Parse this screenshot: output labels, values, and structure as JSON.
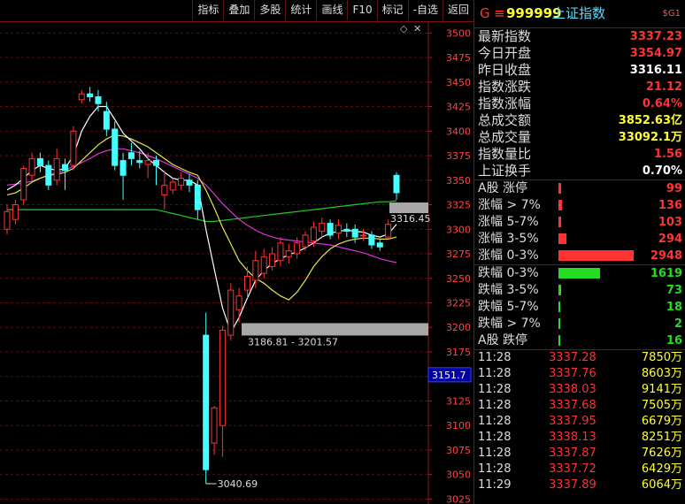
{
  "toolbar": [
    "指标",
    "叠加",
    "多股",
    "统计",
    "画线",
    "F10",
    "标记",
    "-自选",
    "返回"
  ],
  "yaxis": {
    "ticks": [
      3500,
      3475,
      3450,
      3425,
      3400,
      3375,
      3350,
      3325,
      3300,
      3275,
      3250,
      3225,
      3200,
      3175,
      3150,
      3125,
      3100,
      3075,
      3050,
      3025
    ]
  },
  "price_tag": "3316.45",
  "current_tag": "3151.7",
  "range_label": "3186.81 - 3201.57",
  "low_label": "3040.69",
  "header": {
    "g": "G",
    "eq": "≡",
    "code": "999999",
    "name": "上证指数",
    "sg": "$G1"
  },
  "quote": [
    {
      "label": "最新指数",
      "value": "3337.23",
      "color": "#ff3333"
    },
    {
      "label": "今日开盘",
      "value": "3354.97",
      "color": "#ff3333"
    },
    {
      "label": "昨日收盘",
      "value": "3316.11",
      "color": "#ffffff"
    },
    {
      "label": "指数涨跌",
      "value": "21.12",
      "color": "#ff3333"
    },
    {
      "label": "指数涨幅",
      "value": "0.64%",
      "color": "#ff3333"
    },
    {
      "label": "总成交额",
      "value": "3852.63亿",
      "color": "#ffff33"
    },
    {
      "label": "总成交量",
      "value": "33092.1万",
      "color": "#ffff33"
    },
    {
      "label": "指数量比",
      "value": "1.56",
      "color": "#ff3333"
    },
    {
      "label": "上证换手",
      "value": "0.70%",
      "color": "#ffffff"
    }
  ],
  "dist_up": [
    {
      "label": "A股 涨停",
      "value": "99",
      "bar": 0.04
    },
    {
      "label": "涨幅 > 7%",
      "value": "136",
      "bar": 0.05
    },
    {
      "label": "涨幅 5-7%",
      "value": "103",
      "bar": 0.04
    },
    {
      "label": "涨幅 3-5%",
      "value": "294",
      "bar": 0.1
    },
    {
      "label": "涨幅 0-3%",
      "value": "2948",
      "bar": 1.0
    }
  ],
  "dist_down": [
    {
      "label": "跌幅 0-3%",
      "value": "1619",
      "bar": 0.55
    },
    {
      "label": "跌幅 3-5%",
      "value": "73",
      "bar": 0.03
    },
    {
      "label": "跌幅 5-7%",
      "value": "18",
      "bar": 0.01
    },
    {
      "label": "跌幅 > 7%",
      "value": "2",
      "bar": 0.01
    },
    {
      "label": "A股 跌停",
      "value": "16",
      "bar": 0.01
    }
  ],
  "ticks": [
    {
      "time": "11:28",
      "price": "3337.28",
      "vol": "7850万"
    },
    {
      "time": "11:28",
      "price": "3337.76",
      "vol": "8603万"
    },
    {
      "time": "11:28",
      "price": "3338.03",
      "vol": "9141万"
    },
    {
      "time": "11:28",
      "price": "3337.68",
      "vol": "7505万"
    },
    {
      "time": "11:28",
      "price": "3337.95",
      "vol": "6679万"
    },
    {
      "time": "11:28",
      "price": "3338.13",
      "vol": "8251万"
    },
    {
      "time": "11:28",
      "price": "3337.87",
      "vol": "7626万"
    },
    {
      "time": "11:28",
      "price": "3337.72",
      "vol": "6429万"
    },
    {
      "time": "11:29",
      "price": "3337.89",
      "vol": "6064万"
    }
  ],
  "chart_data": {
    "type": "candlestick",
    "ylim": [
      3020,
      3512
    ],
    "candles": [
      {
        "o": 3300,
        "c": 3318,
        "h": 3325,
        "l": 3295
      },
      {
        "o": 3310,
        "c": 3325,
        "h": 3330,
        "l": 3305
      },
      {
        "o": 3330,
        "c": 3362,
        "h": 3365,
        "l": 3325
      },
      {
        "o": 3355,
        "c": 3372,
        "h": 3378,
        "l": 3350
      },
      {
        "o": 3372,
        "c": 3365,
        "h": 3378,
        "l": 3358
      },
      {
        "o": 3365,
        "c": 3345,
        "h": 3370,
        "l": 3340
      },
      {
        "o": 3350,
        "c": 3372,
        "h": 3382,
        "l": 3345
      },
      {
        "o": 3366,
        "c": 3360,
        "h": 3372,
        "l": 3340
      },
      {
        "o": 3365,
        "c": 3400,
        "h": 3405,
        "l": 3360
      },
      {
        "o": 3432,
        "c": 3438,
        "h": 3442,
        "l": 3428
      },
      {
        "o": 3438,
        "c": 3435,
        "h": 3445,
        "l": 3430
      },
      {
        "o": 3435,
        "c": 3428,
        "h": 3442,
        "l": 3420
      },
      {
        "o": 3420,
        "c": 3402,
        "h": 3430,
        "l": 3395
      },
      {
        "o": 3402,
        "c": 3365,
        "h": 3410,
        "l": 3360
      },
      {
        "o": 3370,
        "c": 3355,
        "h": 3378,
        "l": 3330
      },
      {
        "o": 3378,
        "c": 3372,
        "h": 3388,
        "l": 3365
      },
      {
        "o": 3370,
        "c": 3368,
        "h": 3380,
        "l": 3362
      },
      {
        "o": 3366,
        "c": 3370,
        "h": 3378,
        "l": 3352
      },
      {
        "o": 3370,
        "c": 3365,
        "h": 3375,
        "l": 3345
      },
      {
        "o": 3335,
        "c": 3345,
        "h": 3360,
        "l": 3320
      },
      {
        "o": 3340,
        "c": 3348,
        "h": 3352,
        "l": 3336
      },
      {
        "o": 3345,
        "c": 3352,
        "h": 3358,
        "l": 3340
      },
      {
        "o": 3350,
        "c": 3345,
        "h": 3356,
        "l": 3338
      },
      {
        "o": 3345,
        "c": 3320,
        "h": 3350,
        "l": 3310
      },
      {
        "o": 3192,
        "c": 3055,
        "h": 3215,
        "l": 3040.69
      },
      {
        "o": 3082,
        "c": 3118,
        "h": 3120,
        "l": 3070
      },
      {
        "o": 3100,
        "c": 3197,
        "h": 3201.57,
        "l": 3068
      },
      {
        "o": 3192,
        "c": 3238,
        "h": 3245,
        "l": 3186.81
      },
      {
        "o": 3218,
        "c": 3232,
        "h": 3240,
        "l": 3205
      },
      {
        "o": 3238,
        "c": 3252,
        "h": 3262,
        "l": 3230
      },
      {
        "o": 3248,
        "c": 3268,
        "h": 3278,
        "l": 3240
      },
      {
        "o": 3255,
        "c": 3272,
        "h": 3280,
        "l": 3250
      },
      {
        "o": 3262,
        "c": 3275,
        "h": 3282,
        "l": 3258
      },
      {
        "o": 3268,
        "c": 3286,
        "h": 3292,
        "l": 3262
      },
      {
        "o": 3272,
        "c": 3278,
        "h": 3285,
        "l": 3265
      },
      {
        "o": 3275,
        "c": 3286,
        "h": 3292,
        "l": 3270
      },
      {
        "o": 3282,
        "c": 3294,
        "h": 3298,
        "l": 3278
      },
      {
        "o": 3288,
        "c": 3302,
        "h": 3308,
        "l": 3282
      },
      {
        "o": 3298,
        "c": 3306,
        "h": 3312,
        "l": 3292
      },
      {
        "o": 3306,
        "c": 3294,
        "h": 3310,
        "l": 3290
      },
      {
        "o": 3296,
        "c": 3304,
        "h": 3310,
        "l": 3290
      },
      {
        "o": 3300,
        "c": 3298,
        "h": 3306,
        "l": 3292
      },
      {
        "o": 3300,
        "c": 3292,
        "h": 3305,
        "l": 3286
      },
      {
        "o": 3294,
        "c": 3294,
        "h": 3300,
        "l": 3288
      },
      {
        "o": 3294,
        "c": 3284,
        "h": 3298,
        "l": 3280
      },
      {
        "o": 3286,
        "c": 3282,
        "h": 3290,
        "l": 3278
      },
      {
        "o": 3292,
        "c": 3305,
        "h": 3310,
        "l": 3290
      },
      {
        "o": 3354.97,
        "c": 3337.23,
        "h": 3358,
        "l": 3330
      }
    ],
    "ma_white": [
      3340,
      3345,
      3352,
      3360,
      3365,
      3362,
      3360,
      3362,
      3375,
      3400,
      3415,
      3425,
      3425,
      3412,
      3398,
      3390,
      3382,
      3372,
      3365,
      3358,
      3352,
      3350,
      3350,
      3345,
      3300,
      3260,
      3220,
      3195,
      3210,
      3230,
      3248,
      3258,
      3265,
      3270,
      3274,
      3277,
      3281,
      3286,
      3292,
      3296,
      3298,
      3299,
      3298,
      3297,
      3294,
      3292,
      3295,
      3305
    ],
    "ma_yellow": [
      3335,
      3337,
      3342,
      3348,
      3352,
      3355,
      3356,
      3358,
      3362,
      3370,
      3378,
      3386,
      3392,
      3396,
      3395,
      3392,
      3388,
      3384,
      3378,
      3372,
      3366,
      3362,
      3358,
      3355,
      3340,
      3322,
      3302,
      3285,
      3268,
      3258,
      3250,
      3245,
      3238,
      3232,
      3228,
      3236,
      3248,
      3262,
      3272,
      3280,
      3285,
      3288,
      3290,
      3291,
      3291,
      3290,
      3290,
      3292
    ],
    "ma_magenta": [
      3345,
      3346,
      3347,
      3349,
      3352,
      3355,
      3358,
      3360,
      3364,
      3368,
      3372,
      3377,
      3380,
      3382,
      3382,
      3380,
      3378,
      3375,
      3372,
      3368,
      3364,
      3360,
      3356,
      3352,
      3345,
      3336,
      3326,
      3318,
      3310,
      3304,
      3299,
      3295,
      3292,
      3290,
      3289,
      3288,
      3287,
      3286,
      3285,
      3284,
      3282,
      3280,
      3278,
      3276,
      3273,
      3270,
      3268,
      3266
    ],
    "ma_green": [
      3320,
      3320,
      3320,
      3320,
      3320,
      3320,
      3320,
      3320,
      3320,
      3320,
      3320,
      3320,
      3320,
      3320,
      3320,
      3320,
      3320,
      3320,
      3320,
      3318,
      3316,
      3314,
      3312,
      3310,
      3308,
      3308,
      3309,
      3310,
      3311,
      3312,
      3313,
      3314,
      3315,
      3316,
      3317,
      3318,
      3319,
      3320,
      3321,
      3322,
      3323,
      3324,
      3325,
      3326,
      3327,
      3328,
      3328,
      3329
    ]
  }
}
